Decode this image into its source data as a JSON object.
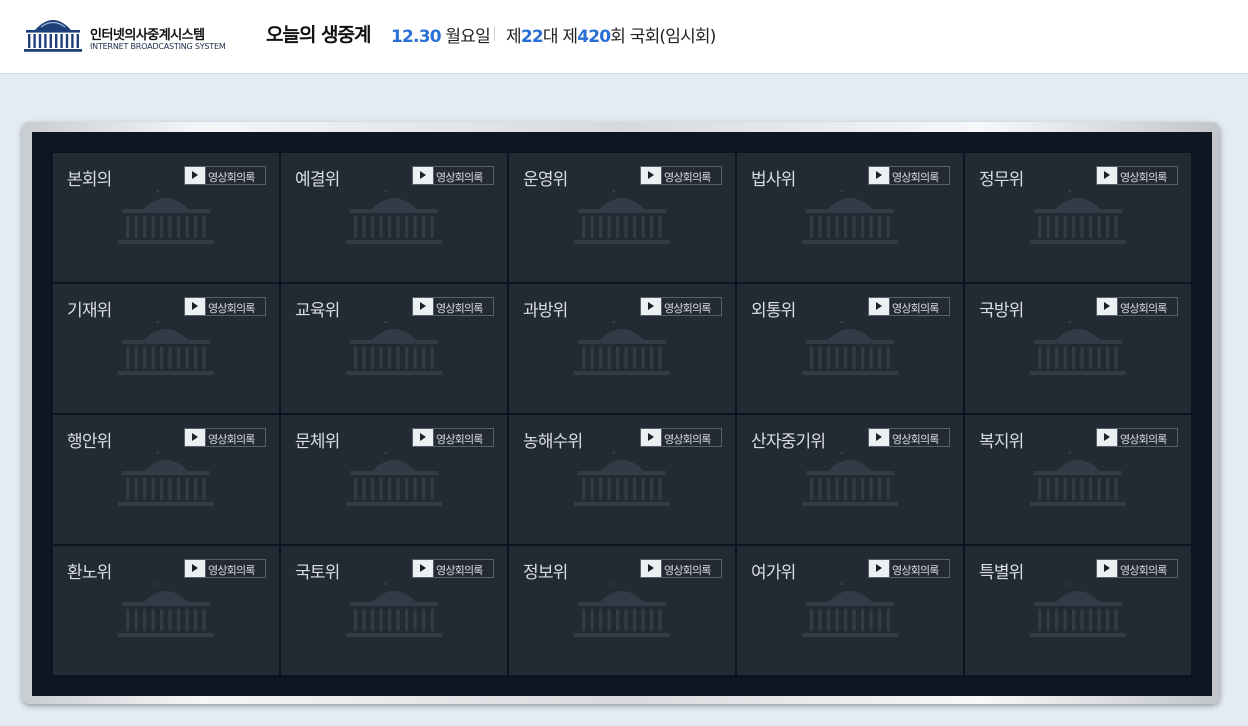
{
  "header": {
    "logo_title": "인터넷의사중계시스템",
    "logo_subtitle": "INTERNET BROADCASTING SYSTEM",
    "title": "오늘의 생중계",
    "date_number": "12.30",
    "weekday": "월요일",
    "session_prefix": "제",
    "assembly_number": "22",
    "session_mid": "대 제",
    "session_number": "420",
    "session_suffix": "회 국회(임시회)"
  },
  "vod_label": "영상회의록",
  "colors": {
    "accent": "#2a6fd6",
    "tile_background": "#222a33",
    "screen_background": "#0e1624"
  },
  "committees": [
    "본회의",
    "예결위",
    "운영위",
    "법사위",
    "정무위",
    "기재위",
    "교육위",
    "과방위",
    "외통위",
    "국방위",
    "행안위",
    "문체위",
    "농해수위",
    "산자중기위",
    "복지위",
    "환노위",
    "국토위",
    "정보위",
    "여가위",
    "특별위"
  ],
  "icons": {
    "logo": "assembly-building-icon",
    "tile_background": "assembly-building-icon",
    "vod": "play-icon"
  }
}
